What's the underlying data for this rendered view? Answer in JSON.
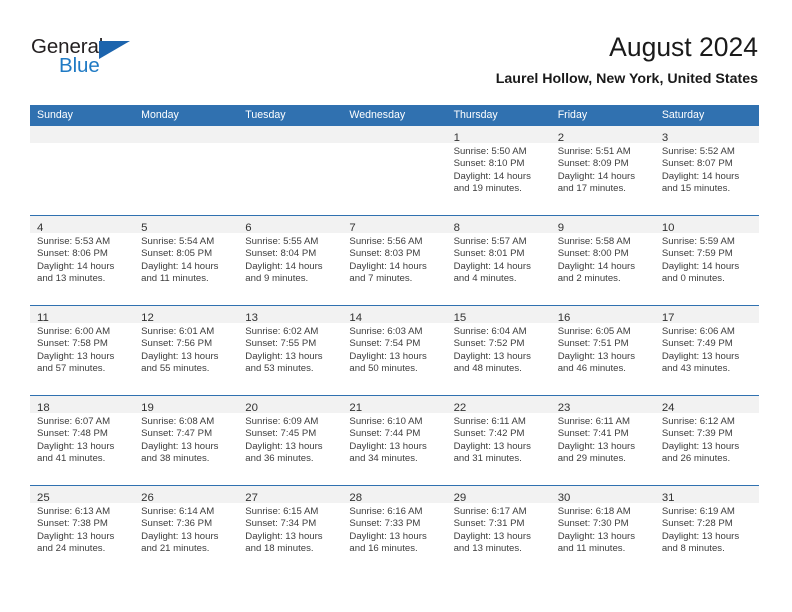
{
  "brand": {
    "name_part1": "General",
    "name_part2": "Blue",
    "logo_icon": "triangle-logo-icon",
    "color_primary": "#1c64ad",
    "color_text": "#231f20"
  },
  "header": {
    "title": "August 2024",
    "subtitle": "Laurel Hollow, New York, United States"
  },
  "theme": {
    "header_blue": "#3071b0",
    "daynum_band": "#f2f2f2",
    "body_text": "#3d3d3d"
  },
  "weekday_headers": [
    "Sunday",
    "Monday",
    "Tuesday",
    "Wednesday",
    "Thursday",
    "Friday",
    "Saturday"
  ],
  "weeks": [
    [
      {
        "day": "",
        "lines": []
      },
      {
        "day": "",
        "lines": []
      },
      {
        "day": "",
        "lines": []
      },
      {
        "day": "",
        "lines": []
      },
      {
        "day": "1",
        "lines": [
          "Sunrise: 5:50 AM",
          "Sunset: 8:10 PM",
          "Daylight: 14 hours",
          "and 19 minutes."
        ]
      },
      {
        "day": "2",
        "lines": [
          "Sunrise: 5:51 AM",
          "Sunset: 8:09 PM",
          "Daylight: 14 hours",
          "and 17 minutes."
        ]
      },
      {
        "day": "3",
        "lines": [
          "Sunrise: 5:52 AM",
          "Sunset: 8:07 PM",
          "Daylight: 14 hours",
          "and 15 minutes."
        ]
      }
    ],
    [
      {
        "day": "4",
        "lines": [
          "Sunrise: 5:53 AM",
          "Sunset: 8:06 PM",
          "Daylight: 14 hours",
          "and 13 minutes."
        ]
      },
      {
        "day": "5",
        "lines": [
          "Sunrise: 5:54 AM",
          "Sunset: 8:05 PM",
          "Daylight: 14 hours",
          "and 11 minutes."
        ]
      },
      {
        "day": "6",
        "lines": [
          "Sunrise: 5:55 AM",
          "Sunset: 8:04 PM",
          "Daylight: 14 hours",
          "and 9 minutes."
        ]
      },
      {
        "day": "7",
        "lines": [
          "Sunrise: 5:56 AM",
          "Sunset: 8:03 PM",
          "Daylight: 14 hours",
          "and 7 minutes."
        ]
      },
      {
        "day": "8",
        "lines": [
          "Sunrise: 5:57 AM",
          "Sunset: 8:01 PM",
          "Daylight: 14 hours",
          "and 4 minutes."
        ]
      },
      {
        "day": "9",
        "lines": [
          "Sunrise: 5:58 AM",
          "Sunset: 8:00 PM",
          "Daylight: 14 hours",
          "and 2 minutes."
        ]
      },
      {
        "day": "10",
        "lines": [
          "Sunrise: 5:59 AM",
          "Sunset: 7:59 PM",
          "Daylight: 14 hours",
          "and 0 minutes."
        ]
      }
    ],
    [
      {
        "day": "11",
        "lines": [
          "Sunrise: 6:00 AM",
          "Sunset: 7:58 PM",
          "Daylight: 13 hours",
          "and 57 minutes."
        ]
      },
      {
        "day": "12",
        "lines": [
          "Sunrise: 6:01 AM",
          "Sunset: 7:56 PM",
          "Daylight: 13 hours",
          "and 55 minutes."
        ]
      },
      {
        "day": "13",
        "lines": [
          "Sunrise: 6:02 AM",
          "Sunset: 7:55 PM",
          "Daylight: 13 hours",
          "and 53 minutes."
        ]
      },
      {
        "day": "14",
        "lines": [
          "Sunrise: 6:03 AM",
          "Sunset: 7:54 PM",
          "Daylight: 13 hours",
          "and 50 minutes."
        ]
      },
      {
        "day": "15",
        "lines": [
          "Sunrise: 6:04 AM",
          "Sunset: 7:52 PM",
          "Daylight: 13 hours",
          "and 48 minutes."
        ]
      },
      {
        "day": "16",
        "lines": [
          "Sunrise: 6:05 AM",
          "Sunset: 7:51 PM",
          "Daylight: 13 hours",
          "and 46 minutes."
        ]
      },
      {
        "day": "17",
        "lines": [
          "Sunrise: 6:06 AM",
          "Sunset: 7:49 PM",
          "Daylight: 13 hours",
          "and 43 minutes."
        ]
      }
    ],
    [
      {
        "day": "18",
        "lines": [
          "Sunrise: 6:07 AM",
          "Sunset: 7:48 PM",
          "Daylight: 13 hours",
          "and 41 minutes."
        ]
      },
      {
        "day": "19",
        "lines": [
          "Sunrise: 6:08 AM",
          "Sunset: 7:47 PM",
          "Daylight: 13 hours",
          "and 38 minutes."
        ]
      },
      {
        "day": "20",
        "lines": [
          "Sunrise: 6:09 AM",
          "Sunset: 7:45 PM",
          "Daylight: 13 hours",
          "and 36 minutes."
        ]
      },
      {
        "day": "21",
        "lines": [
          "Sunrise: 6:10 AM",
          "Sunset: 7:44 PM",
          "Daylight: 13 hours",
          "and 34 minutes."
        ]
      },
      {
        "day": "22",
        "lines": [
          "Sunrise: 6:11 AM",
          "Sunset: 7:42 PM",
          "Daylight: 13 hours",
          "and 31 minutes."
        ]
      },
      {
        "day": "23",
        "lines": [
          "Sunrise: 6:11 AM",
          "Sunset: 7:41 PM",
          "Daylight: 13 hours",
          "and 29 minutes."
        ]
      },
      {
        "day": "24",
        "lines": [
          "Sunrise: 6:12 AM",
          "Sunset: 7:39 PM",
          "Daylight: 13 hours",
          "and 26 minutes."
        ]
      }
    ],
    [
      {
        "day": "25",
        "lines": [
          "Sunrise: 6:13 AM",
          "Sunset: 7:38 PM",
          "Daylight: 13 hours",
          "and 24 minutes."
        ]
      },
      {
        "day": "26",
        "lines": [
          "Sunrise: 6:14 AM",
          "Sunset: 7:36 PM",
          "Daylight: 13 hours",
          "and 21 minutes."
        ]
      },
      {
        "day": "27",
        "lines": [
          "Sunrise: 6:15 AM",
          "Sunset: 7:34 PM",
          "Daylight: 13 hours",
          "and 18 minutes."
        ]
      },
      {
        "day": "28",
        "lines": [
          "Sunrise: 6:16 AM",
          "Sunset: 7:33 PM",
          "Daylight: 13 hours",
          "and 16 minutes."
        ]
      },
      {
        "day": "29",
        "lines": [
          "Sunrise: 6:17 AM",
          "Sunset: 7:31 PM",
          "Daylight: 13 hours",
          "and 13 minutes."
        ]
      },
      {
        "day": "30",
        "lines": [
          "Sunrise: 6:18 AM",
          "Sunset: 7:30 PM",
          "Daylight: 13 hours",
          "and 11 minutes."
        ]
      },
      {
        "day": "31",
        "lines": [
          "Sunrise: 6:19 AM",
          "Sunset: 7:28 PM",
          "Daylight: 13 hours",
          "and 8 minutes."
        ]
      }
    ]
  ]
}
